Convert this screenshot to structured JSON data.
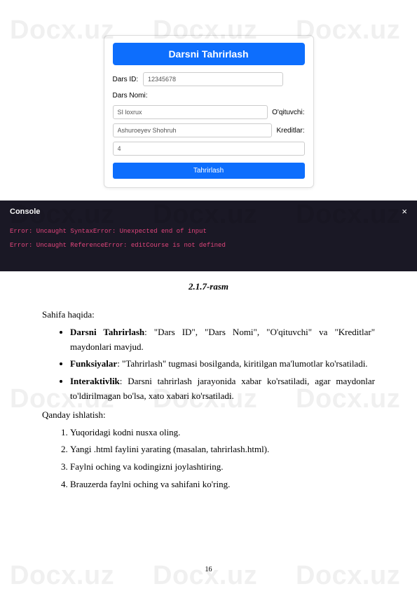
{
  "watermark": "Docx.uz",
  "form": {
    "title": "Darsni Tahrirlash",
    "id_label": "Dars ID:",
    "id_value": "12345678",
    "name_label": "Dars Nomi:",
    "name_value": "SI loxrux",
    "teacher_label": "O'qituvchi:",
    "teacher_value": "Ashuroeyev Shohruh",
    "credits_label": "Kreditlar:",
    "credits_value": "4",
    "submit": "Tahrirlash"
  },
  "console": {
    "title": "Console",
    "close": "×",
    "line1": "Error: Uncaught SyntaxError: Unexpected end of input",
    "line2": "Error: Uncaught ReferenceError: editCourse is not defined"
  },
  "caption": "2.1.7-rasm",
  "text": {
    "sahifa_head": "Sahifa haqida:",
    "b1_strong": "Darsni Tahrirlash",
    "b1_rest": ": \"Dars ID\", \"Dars Nomi\", \"O'qituvchi\" va \"Kreditlar\" maydonlari mavjud.",
    "b2_strong": "Funksiyalar",
    "b2_rest": ": \"Tahrirlash\" tugmasi bosilganda, kiritilgan ma'lumotlar ko'rsatiladi.",
    "b3_strong": "Interaktivlik",
    "b3_rest": ": Darsni tahrirlash jarayonida xabar ko'rsatiladi, agar maydonlar to'ldirilmagan bo'lsa, xato xabari ko'rsatiladi.",
    "qanday_head": "Qanday ishlatish:",
    "n1": "Yuqoridagi kodni nusxa oling.",
    "n2": "Yangi .html faylini yarating (masalan, tahrirlash.html).",
    "n3": "Faylni oching va kodingizni joylashtiring.",
    "n4": "Brauzerda faylni oching va sahifani ko'ring."
  },
  "page_number": "16"
}
